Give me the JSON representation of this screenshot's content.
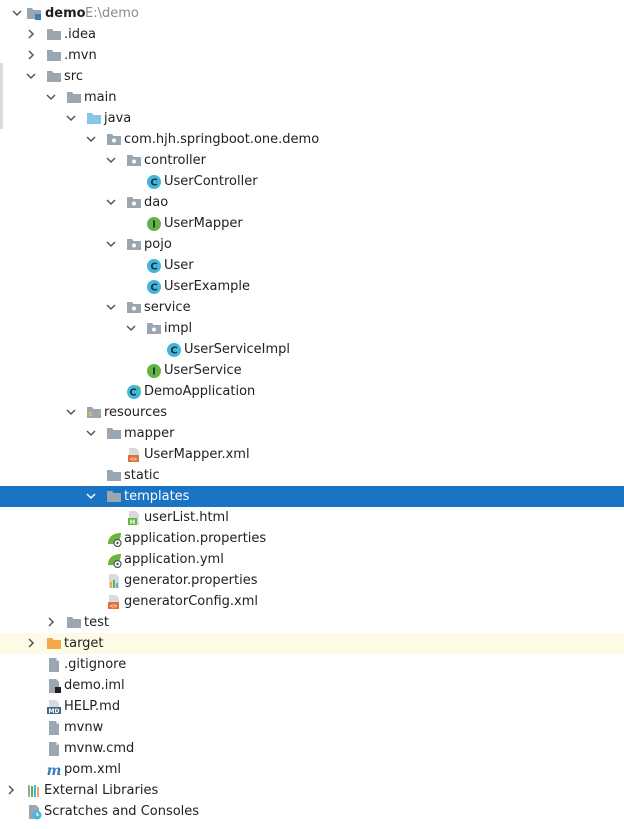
{
  "project_tree": {
    "root": {
      "label": "demo",
      "hint": "E:\\demo"
    },
    "items": [
      {
        "name": "folder-idea",
        "label": ".idea",
        "icon": "folder-icon",
        "arrow": "right",
        "level": 1
      },
      {
        "name": "folder-mvn",
        "label": ".mvn",
        "icon": "folder-icon",
        "arrow": "right",
        "level": 1
      },
      {
        "name": "folder-src",
        "label": "src",
        "icon": "folder-icon",
        "arrow": "down",
        "level": 1
      },
      {
        "name": "folder-main",
        "label": "main",
        "icon": "folder-icon",
        "arrow": "down",
        "level": 2
      },
      {
        "name": "folder-java",
        "label": "java",
        "icon": "source-folder-icon",
        "arrow": "down",
        "level": 3
      },
      {
        "name": "package-demo",
        "label": "com.hjh.springboot.one.demo",
        "icon": "package-icon",
        "arrow": "down",
        "level": 4
      },
      {
        "name": "package-controller",
        "label": "controller",
        "icon": "package-icon",
        "arrow": "down",
        "level": 5
      },
      {
        "name": "class-usercontroller",
        "label": "UserController",
        "icon": "class-icon",
        "arrow": "none",
        "level": 6
      },
      {
        "name": "package-dao",
        "label": "dao",
        "icon": "package-icon",
        "arrow": "down",
        "level": 5
      },
      {
        "name": "interface-usermapper",
        "label": "UserMapper",
        "icon": "interface-icon",
        "arrow": "none",
        "level": 6
      },
      {
        "name": "package-pojo",
        "label": "pojo",
        "icon": "package-icon",
        "arrow": "down",
        "level": 5
      },
      {
        "name": "class-user",
        "label": "User",
        "icon": "class-icon",
        "arrow": "none",
        "level": 6
      },
      {
        "name": "class-userexample",
        "label": "UserExample",
        "icon": "class-icon",
        "arrow": "none",
        "level": 6
      },
      {
        "name": "package-service",
        "label": "service",
        "icon": "package-icon",
        "arrow": "down",
        "level": 5
      },
      {
        "name": "package-impl",
        "label": "impl",
        "icon": "package-icon",
        "arrow": "down",
        "level": 6
      },
      {
        "name": "class-userserviceimpl",
        "label": "UserServiceImpl",
        "icon": "class-icon",
        "arrow": "none",
        "level": 7
      },
      {
        "name": "interface-userservice",
        "label": "UserService",
        "icon": "interface-icon",
        "arrow": "none",
        "level": 6
      },
      {
        "name": "class-demoapplication",
        "label": "DemoApplication",
        "icon": "spring-boot-class-icon",
        "arrow": "none",
        "level": 5
      },
      {
        "name": "folder-resources",
        "label": "resources",
        "icon": "resources-folder-icon",
        "arrow": "down",
        "level": 3
      },
      {
        "name": "folder-mapper",
        "label": "mapper",
        "icon": "folder-icon",
        "arrow": "down",
        "level": 4
      },
      {
        "name": "file-usermapper-xml",
        "label": "UserMapper.xml",
        "icon": "xml-file-icon",
        "arrow": "none",
        "level": 5
      },
      {
        "name": "folder-static",
        "label": "static",
        "icon": "folder-icon",
        "arrow": "none",
        "level": 4
      },
      {
        "name": "folder-templates",
        "label": "templates",
        "icon": "folder-icon",
        "arrow": "down",
        "level": 4,
        "selected": true
      },
      {
        "name": "file-userlist-html",
        "label": "userList.html",
        "icon": "html-file-icon",
        "arrow": "none",
        "level": 5
      },
      {
        "name": "file-application-properties",
        "label": "application.properties",
        "icon": "spring-config-icon",
        "arrow": "none",
        "level": 4
      },
      {
        "name": "file-application-yml",
        "label": "application.yml",
        "icon": "spring-config-icon",
        "arrow": "none",
        "level": 4
      },
      {
        "name": "file-generator-properties",
        "label": "generator.properties",
        "icon": "properties-file-icon",
        "arrow": "none",
        "level": 4
      },
      {
        "name": "file-generatorconfig-xml",
        "label": "generatorConfig.xml",
        "icon": "xml-file-icon",
        "arrow": "none",
        "level": 4
      },
      {
        "name": "folder-test",
        "label": "test",
        "icon": "folder-icon",
        "arrow": "right",
        "level": 2
      },
      {
        "name": "folder-target",
        "label": "target",
        "icon": "excluded-folder-icon",
        "arrow": "right",
        "level": 1,
        "highlight": true
      },
      {
        "name": "file-gitignore",
        "label": ".gitignore",
        "icon": "text-file-icon",
        "arrow": "none",
        "level": 1
      },
      {
        "name": "file-demo-iml",
        "label": "demo.iml",
        "icon": "module-file-icon",
        "arrow": "none",
        "level": 1
      },
      {
        "name": "file-help-md",
        "label": "HELP.md",
        "icon": "markdown-file-icon",
        "arrow": "none",
        "level": 1
      },
      {
        "name": "file-mvnw",
        "label": "mvnw",
        "icon": "text-file-icon",
        "arrow": "none",
        "level": 1
      },
      {
        "name": "file-mvnw-cmd",
        "label": "mvnw.cmd",
        "icon": "text-file-icon",
        "arrow": "none",
        "level": 1
      },
      {
        "name": "file-pom-xml",
        "label": "pom.xml",
        "icon": "maven-file-icon",
        "arrow": "none",
        "level": 1
      },
      {
        "name": "external-libraries",
        "label": "External Libraries",
        "icon": "libraries-icon",
        "arrow": "right",
        "level": 0
      },
      {
        "name": "scratches-and-consoles",
        "label": "Scratches and Consoles",
        "icon": "scratches-icon",
        "arrow": "none",
        "level": 0
      }
    ]
  },
  "colors": {
    "selection": "#1b73c4",
    "highlight_row": "#fdfbe5",
    "folder": "#9aa7b0",
    "source_folder": "#87c6ea",
    "excluded_folder": "#f0a848",
    "class_circle": "#40b6e0",
    "interface_circle": "#62b543",
    "hint_text": "#8c8c8c"
  }
}
